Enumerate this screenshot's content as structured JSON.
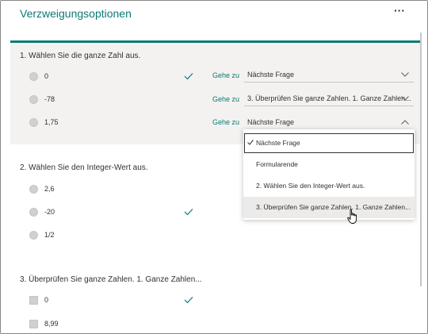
{
  "title": "Verzweigungsoptionen",
  "more_icon": "ellipsis-icon",
  "colors": {
    "accent": "#0b7a75",
    "panel": "#f3f2f1"
  },
  "questions": [
    {
      "title": "1. Wählen Sie die ganze Zahl aus.",
      "options": [
        {
          "label": "0",
          "correct": true,
          "goto": "Gehe zu",
          "branch": "Nächste Frage"
        },
        {
          "label": "-78",
          "correct": false,
          "goto": "Gehe zu",
          "branch": "3. Überprüfen Sie ganze Zahlen. 1. Ganze Zahlen..."
        },
        {
          "label": "1,75",
          "correct": false,
          "goto": "Gehe zu",
          "branch": "Nächste Frage"
        }
      ]
    },
    {
      "title": "2. Wählen Sie den Integer-Wert aus.",
      "options": [
        {
          "label": "2,6",
          "correct": false
        },
        {
          "label": "-20",
          "correct": true
        },
        {
          "label": "1/2",
          "correct": false
        }
      ]
    },
    {
      "title": "3. Überprüfen Sie ganze Zahlen. 1. Ganze Zahlen...",
      "options": [
        {
          "label": "0",
          "correct": true
        },
        {
          "label": "8,99",
          "correct": false
        }
      ]
    }
  ],
  "dropdown_menu": {
    "items": [
      "Nächste Frage",
      "Formularende",
      "2. Wählen Sie den Integer-Wert aus.",
      "3. Überprüfen Sie ganze Zahlen. 1. Ganze Zahlen..."
    ],
    "selected": "Nächste Frage",
    "hovered": "3. Überprüfen Sie ganze Zahlen. 1. Ganze Zahlen..."
  }
}
